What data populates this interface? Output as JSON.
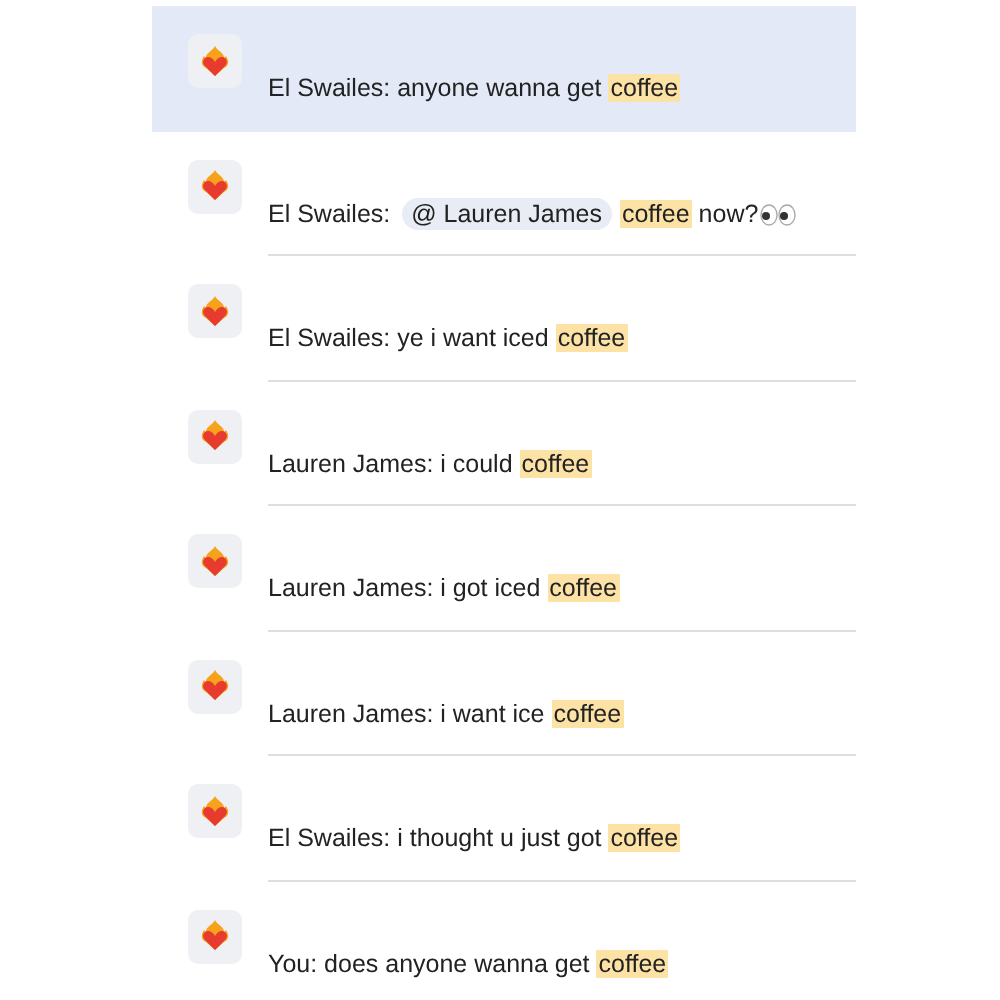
{
  "messages": [
    {
      "selected": true,
      "parts": [
        {
          "kind": "text",
          "text": "El Swailes: anyone wanna get "
        },
        {
          "kind": "highlight",
          "text": "coffee"
        }
      ]
    },
    {
      "selected": false,
      "parts": [
        {
          "kind": "text",
          "text": "El Swailes: "
        },
        {
          "kind": "mention",
          "text": "@ Lauren James"
        },
        {
          "kind": "highlight",
          "text": "coffee"
        },
        {
          "kind": "text",
          "text": " now?"
        },
        {
          "kind": "icon"
        }
      ]
    },
    {
      "selected": false,
      "parts": [
        {
          "kind": "text",
          "text": "El Swailes: ye i want iced "
        },
        {
          "kind": "highlight",
          "text": "coffee"
        }
      ]
    },
    {
      "selected": false,
      "parts": [
        {
          "kind": "text",
          "text": "Lauren James: i could "
        },
        {
          "kind": "highlight",
          "text": "coffee"
        }
      ]
    },
    {
      "selected": false,
      "parts": [
        {
          "kind": "text",
          "text": "Lauren James: i got iced "
        },
        {
          "kind": "highlight",
          "text": "coffee"
        }
      ]
    },
    {
      "selected": false,
      "parts": [
        {
          "kind": "text",
          "text": "Lauren James: i want ice "
        },
        {
          "kind": "highlight",
          "text": "coffee"
        }
      ]
    },
    {
      "selected": false,
      "parts": [
        {
          "kind": "text",
          "text": "El Swailes: i thought u just got "
        },
        {
          "kind": "highlight",
          "text": "coffee"
        }
      ]
    },
    {
      "selected": false,
      "parts": [
        {
          "kind": "text",
          "text": "You: does anyone wanna get "
        },
        {
          "kind": "highlight",
          "text": "coffee"
        }
      ]
    }
  ]
}
